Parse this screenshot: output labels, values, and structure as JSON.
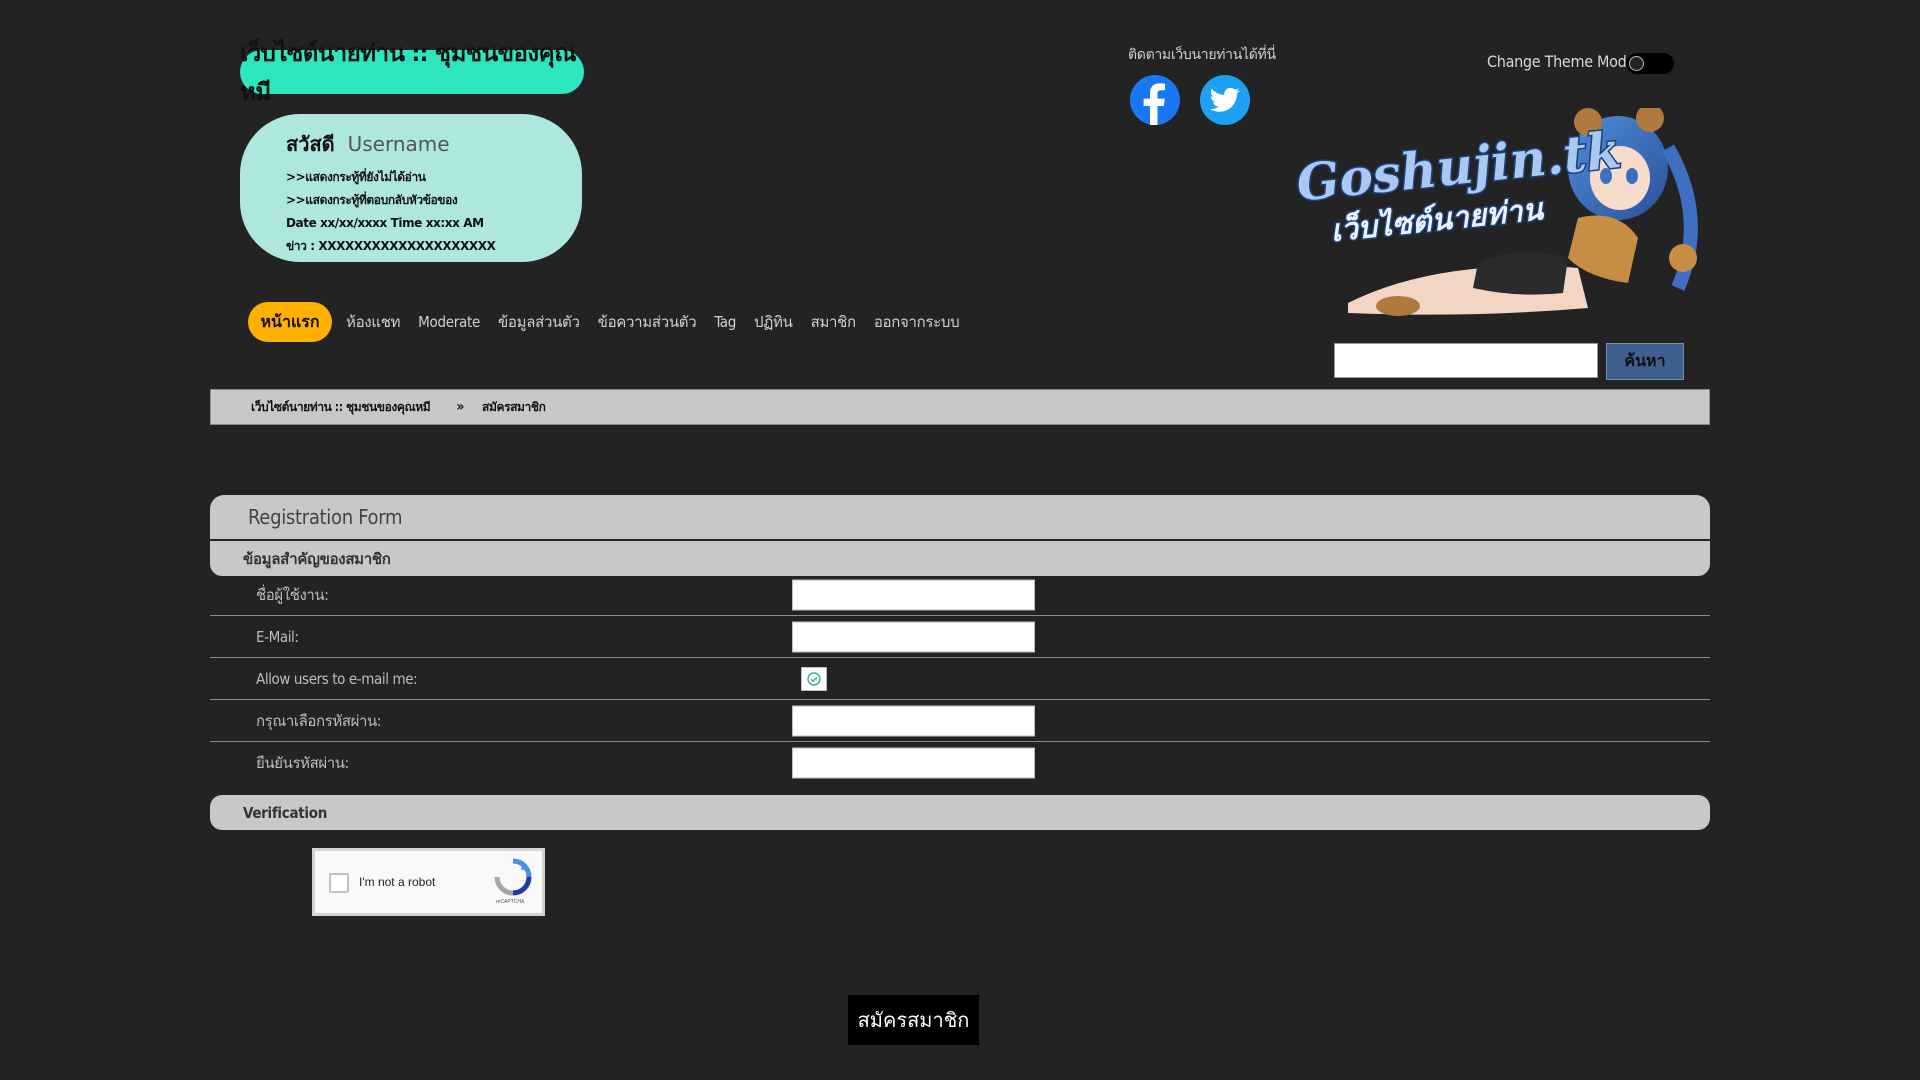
{
  "header": {
    "site_title": "เว็บไซต์นายท่าน :: ชุมชนของคุณหมี",
    "social_caption": "ติดตามเว็บนายท่านได้ที่นี่",
    "theme_label": "Change Theme Mode",
    "banner_text_line1": "Goshujin.tk",
    "banner_text_line2": "เว็บไซต์นายท่าน"
  },
  "user_panel": {
    "greeting": "สวัสดี",
    "username": "Username",
    "unread_link": ">>แสดงกระทู้ที่ยังไม่ได้อ่าน",
    "replies_link": ">>แสดงกระทู้ที่ตอบกลับหัวข้อของ",
    "datetime": "Date xx/xx/xxxx Time xx:xx AM",
    "news": "ข่าว : XXXXXXXXXXXXXXXXXXXX"
  },
  "nav": {
    "items": [
      "หน้าแรก",
      "ห้องแชท",
      "Moderate",
      "ข้อมูลส่วนตัว",
      "ข้อความส่วนตัว",
      "Tag",
      "ปฏิทิน",
      "สมาชิก",
      "ออกจากระบบ"
    ]
  },
  "search": {
    "placeholder": "",
    "button_label": "ค้นหา"
  },
  "breadcrumb": {
    "home": "เว็บไซต์นายท่าน :: ชุมชนของคุณหมี",
    "separator": "»",
    "current": "สมัครสมาชิก"
  },
  "form": {
    "title": "Registration Form",
    "section_member": "ข้อมูลสำคัญของสมาชิก",
    "fields": [
      {
        "label": "ชื่อผู้ใช้งาน:",
        "value": ""
      },
      {
        "label": "E-Mail:",
        "value": ""
      },
      {
        "label": "Allow users to e-mail me:",
        "checked": true
      },
      {
        "label": "กรุณาเลือกรหัสผ่าน:",
        "value": ""
      },
      {
        "label": "ยืนยันรหัสผ่าน:",
        "value": ""
      }
    ],
    "section_verify": "Verification",
    "captcha_text": "I'm not a robot",
    "captcha_brand": "reCAPTCHA",
    "submit_label": "สมัครสมาชิก"
  },
  "colors": {
    "background": "#232323",
    "title_pill": "#2ee6bd",
    "user_panel": "#aee7e0",
    "home_button": "#ffb000",
    "search_button": "#3f5f8e",
    "section_bar": "#c8c8c8"
  }
}
